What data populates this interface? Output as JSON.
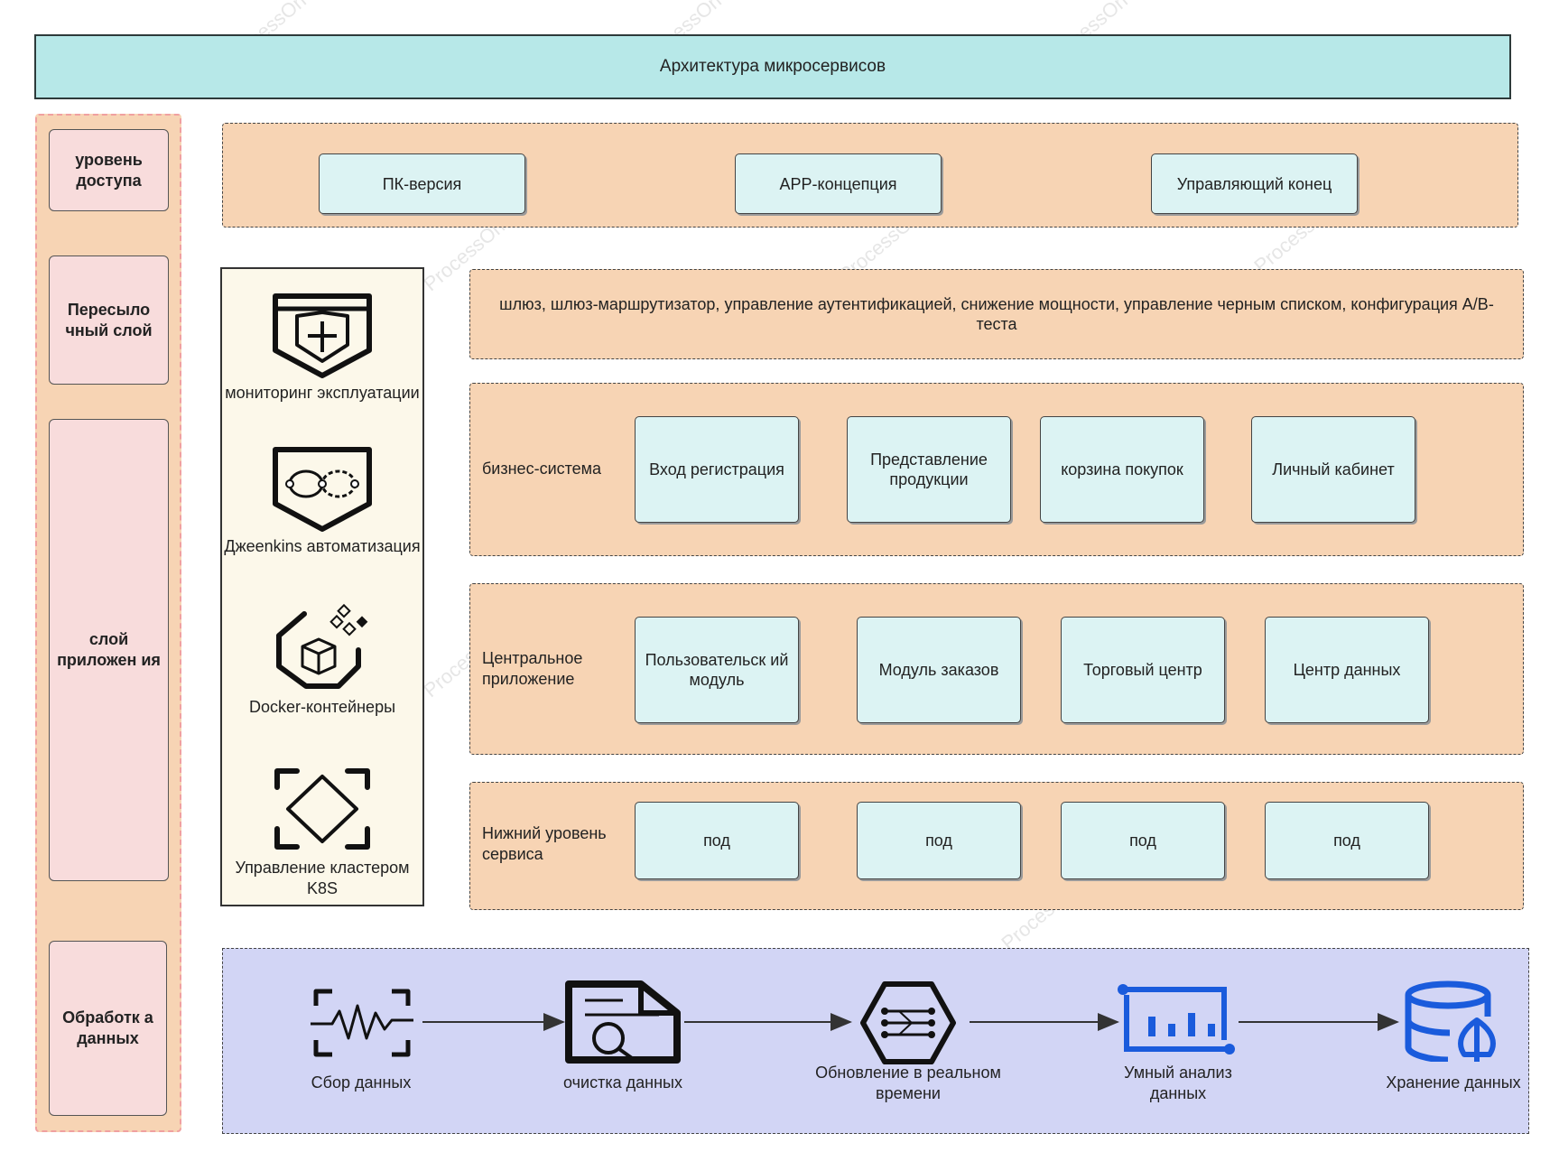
{
  "title": "Архитектура микросервисов",
  "layers": {
    "access": "уровень доступа",
    "forwarding": "Пересыло чный слой",
    "application": "слой приложен ия",
    "data": "Обработк а данных"
  },
  "access_panel": {
    "items": [
      "ПК-версия",
      "APP-концепция",
      "Управляющий конец"
    ]
  },
  "gateway_panel": {
    "text": "шлюз, шлюз-маршрутизатор, управление аутентификацией, снижение мощности, управление черным списком, конфигурация A/B-теста"
  },
  "business_panel": {
    "label": "бизнес-система",
    "items": [
      "Вход регистрация",
      "Представление продукции",
      "корзина покупок",
      "Личный кабинет"
    ]
  },
  "central_panel": {
    "label": "Центральное приложение",
    "items": [
      "Пользовательск ий модуль",
      "Модуль заказов",
      "Торговый центр",
      "Центр данных"
    ]
  },
  "service_panel": {
    "label": "Нижний уровень сервиса",
    "items": [
      "под",
      "под",
      "под",
      "под"
    ]
  },
  "ops_tools": [
    {
      "label": "мониторинг эксплуатации",
      "icon": "shield-icon"
    },
    {
      "label": "Джeenkins автоматизация",
      "icon": "infinity-loop-icon"
    },
    {
      "label": "Docker-контейнеры",
      "icon": "container-cube-icon"
    },
    {
      "label": "Управление кластером K8S",
      "icon": "cluster-diamond-icon"
    }
  ],
  "data_flow": [
    {
      "label": "Сбор данных",
      "icon": "waveform-icon"
    },
    {
      "label": "очистка данных",
      "icon": "document-search-icon"
    },
    {
      "label": "Обновление в реальном времени",
      "icon": "hexagon-network-icon"
    },
    {
      "label": "Умный анализ данных",
      "icon": "bar-chart-icon"
    },
    {
      "label": "Хранение данных",
      "icon": "database-icon"
    }
  ],
  "watermark": "ProcessOn Бесплатная схема",
  "colors": {
    "title_fill": "#b7e8e8",
    "panel_fill": "#f7d4b4",
    "layer_label_fill": "#f8dcdc",
    "box_fill": "#dcf3f3",
    "data_panel_fill": "#d2d5f5",
    "ops_fill": "#fcf8ea",
    "data_icon_blue": "#1a5bdc"
  }
}
